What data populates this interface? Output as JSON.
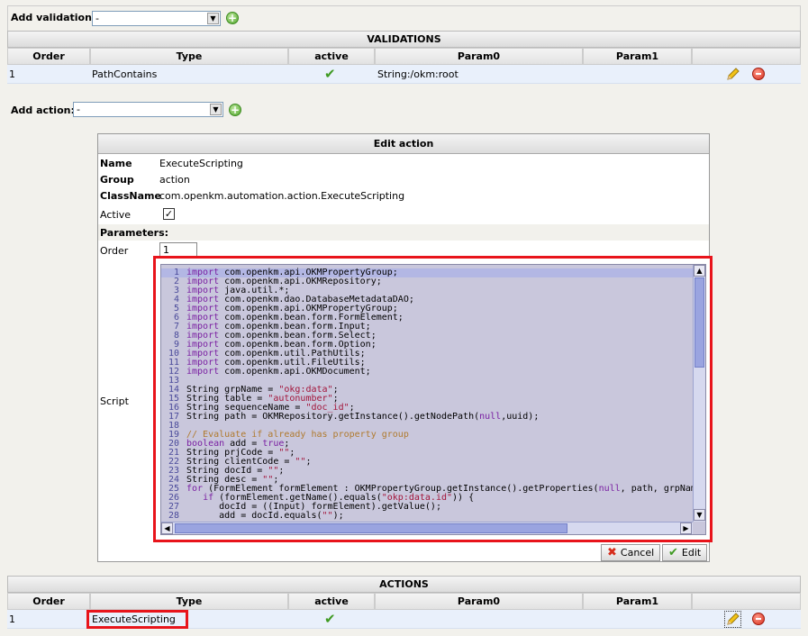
{
  "validation_bar": {
    "label": "Add validation:",
    "select_value": "-"
  },
  "validations": {
    "title": "VALIDATIONS",
    "columns": [
      "Order",
      "Type",
      "active",
      "Param0",
      "Param1"
    ],
    "rows": [
      {
        "order": "1",
        "type": "PathContains",
        "param0": "String:/okm:root",
        "param1": ""
      }
    ]
  },
  "action_bar": {
    "label": "Add action:",
    "select_value": "-"
  },
  "edit_action": {
    "title": "Edit action",
    "name_label": "Name",
    "name_value": "ExecuteScripting",
    "group_label": "Group",
    "group_value": "action",
    "classname_label": "ClassName",
    "classname_value": "com.openkm.automation.action.ExecuteScripting",
    "active_label": "Active",
    "parameters_label": "Parameters:",
    "order_label": "Order",
    "order_value": "1",
    "script_label": "Script",
    "cancel_label": "Cancel",
    "edit_label": "Edit"
  },
  "code_lines": [
    "import com.openkm.api.OKMPropertyGroup;",
    "import com.openkm.api.OKMRepository;",
    "import java.util.*;",
    "import com.openkm.dao.DatabaseMetadataDAO;",
    "import com.openkm.api.OKMPropertyGroup;",
    "import com.openkm.bean.form.FormElement;",
    "import com.openkm.bean.form.Input;",
    "import com.openkm.bean.form.Select;",
    "import com.openkm.bean.form.Option;",
    "import com.openkm.util.PathUtils;",
    "import com.openkm.util.FileUtils;",
    "import com.openkm.api.OKMDocument;",
    "",
    "String grpName = \"okg:data\";",
    "String table = \"autonumber\";",
    "String sequenceName = \"doc_id\";",
    "String path = OKMRepository.getInstance().getNodePath(null,uuid);",
    "",
    "// Evaluate if already has property group",
    "boolean add = true;",
    "String prjCode = \"\";",
    "String clientCode = \"\";",
    "String docId = \"\";",
    "String desc = \"\";",
    "for (FormElement formElement : OKMPropertyGroup.getInstance().getProperties(null, path, grpName)) {",
    "   if (formElement.getName().equals(\"okp:data.id\")) {",
    "      docId = ((Input) formElement).getValue();",
    "      add = docId.equals(\"\");"
  ],
  "actions": {
    "title": "ACTIONS",
    "columns": [
      "Order",
      "Type",
      "active",
      "Param0",
      "Param1"
    ],
    "rows": [
      {
        "order": "1",
        "type": "ExecuteScripting",
        "param0": "",
        "param1": ""
      }
    ]
  },
  "colors": {
    "highlight_red": "#e8141b",
    "row_bg": "#e9f0fb",
    "code_bg": "#c9c7dc"
  }
}
